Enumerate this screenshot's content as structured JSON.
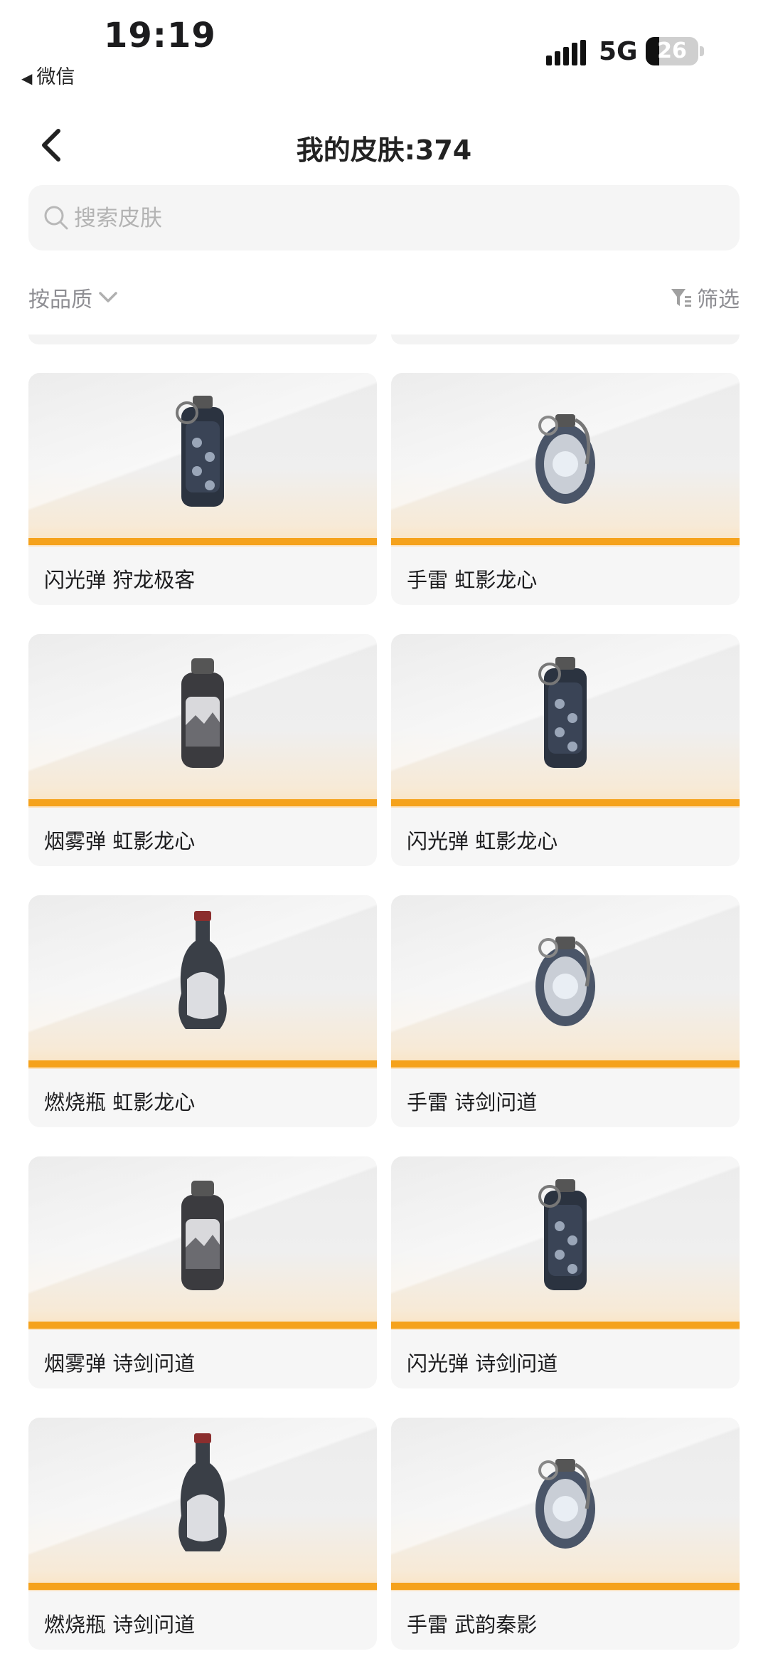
{
  "status_bar": {
    "time": "19:19",
    "back_app": "微信",
    "network": "5G",
    "battery": "26",
    "battery_fraction": 0.26
  },
  "nav": {
    "title": "我的皮肤:374"
  },
  "search": {
    "placeholder": "搜索皮肤",
    "value": ""
  },
  "toolbar": {
    "sort_label": "按品质",
    "filter_label": "筛选"
  },
  "colors": {
    "quality_bar": "#f5a21c",
    "card_bg": "#f6f6f6"
  },
  "items": [
    {
      "label": "闪光弹 狩龙极客",
      "icon": "flashbang-icon"
    },
    {
      "label": "手雷 虹影龙心",
      "icon": "grenade-icon"
    },
    {
      "label": "烟雾弹 虹影龙心",
      "icon": "smoke-grenade-icon"
    },
    {
      "label": "闪光弹 虹影龙心",
      "icon": "flashbang-icon"
    },
    {
      "label": "燃烧瓶 虹影龙心",
      "icon": "molotov-icon"
    },
    {
      "label": "手雷 诗剑问道",
      "icon": "grenade-icon"
    },
    {
      "label": "烟雾弹 诗剑问道",
      "icon": "smoke-grenade-icon"
    },
    {
      "label": "闪光弹 诗剑问道",
      "icon": "flashbang-icon"
    },
    {
      "label": "燃烧瓶 诗剑问道",
      "icon": "molotov-icon"
    },
    {
      "label": "手雷 武韵秦影",
      "icon": "grenade-icon"
    }
  ]
}
